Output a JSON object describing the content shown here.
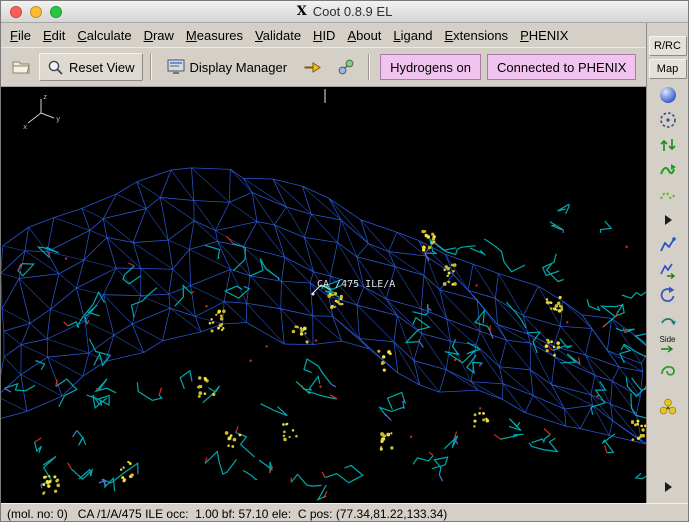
{
  "window": {
    "title": "Coot 0.8.9 EL"
  },
  "menu": {
    "items": [
      "File",
      "Edit",
      "Calculate",
      "Draw",
      "Measures",
      "Validate",
      "HID",
      "About",
      "Ligand",
      "Extensions",
      "PHENIX"
    ]
  },
  "toolbar": {
    "reset_view_label": "Reset View",
    "display_manager_label": "Display Manager",
    "hydrogens_label": "Hydrogens on",
    "phenix_label": "Connected to PHENIX"
  },
  "sidebar": {
    "rrc_label": "R/RC",
    "map_label": "Map",
    "side_label": "Side"
  },
  "icons": {
    "toolbar": [
      "open-coordinates-icon",
      "magnifier-icon",
      "display-manager-icon",
      "go-to-atom-icon",
      "environment-distances-icon"
    ],
    "sidebar": [
      "sphere-refine-icon",
      "refine-range-icon",
      "rigid-body-fit-icon",
      "real-space-refine-icon",
      "regularize-zone-icon",
      "expander-icon",
      "auto-fit-rotamer-icon",
      "rotamers-icon",
      "edit-chi-angles-icon",
      "flip-peptide-icon",
      "side-chain-flip-icon",
      "jed-flip-icon",
      "yellow-trefoil-icon",
      "more-tools-icon"
    ]
  },
  "scene": {
    "atom_label": "CA /475 ILE/A",
    "axes": [
      "x",
      "y",
      "z"
    ]
  },
  "colors": {
    "map_mesh": "#2e5fe6",
    "model_carbon": "#00b4b4",
    "oxygen": "#dd3333",
    "nitrogen": "#6a6af0",
    "sulfur_dots": "#cdbb2a",
    "sulfur_dots_bright": "#efe23c",
    "badge_pink": "#f0c4ee",
    "close_btn": "#ff5f57",
    "minimize_btn": "#febc2e",
    "zoom_btn": "#28c840"
  },
  "statusbar": {
    "text": "(mol. no: 0)   CA /1/A/475 ILE occ:  1.00 bf: 57.10 ele:  C pos: (77.34,81.22,133.34)"
  }
}
